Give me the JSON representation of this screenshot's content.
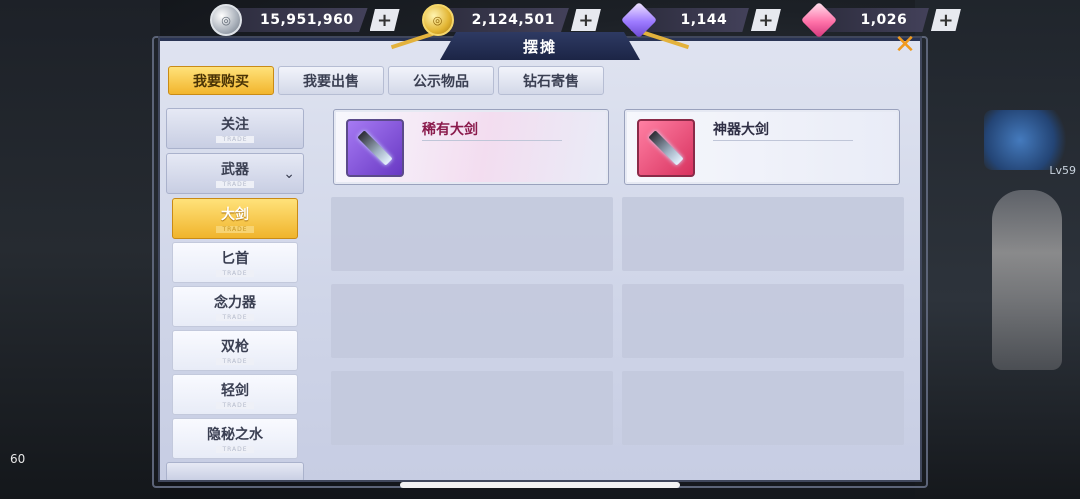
{
  "currencies": [
    {
      "icon": "silver-coin-icon",
      "value": "15,951,960"
    },
    {
      "icon": "gold-coin-icon",
      "value": "2,124,501"
    },
    {
      "icon": "purple-diamond-icon",
      "value": "1,144"
    },
    {
      "icon": "pink-diamond-icon",
      "value": "1,026"
    }
  ],
  "panel": {
    "title": "摆摊"
  },
  "tabs": [
    {
      "label": "我要购买",
      "active": true
    },
    {
      "label": "我要出售",
      "active": false
    },
    {
      "label": "公示物品",
      "active": false
    },
    {
      "label": "钻石寄售",
      "active": false
    }
  ],
  "sidebar": {
    "categories": [
      {
        "label": "关注",
        "sub": "TRADE"
      },
      {
        "label": "武器",
        "sub": "TRADE",
        "expanded": true
      }
    ],
    "subcategories": [
      {
        "label": "大剑",
        "sub": "TRADE",
        "active": true
      },
      {
        "label": "匕首",
        "sub": "TRADE"
      },
      {
        "label": "念力器",
        "sub": "TRADE"
      },
      {
        "label": "双枪",
        "sub": "TRADE"
      },
      {
        "label": "轻剑",
        "sub": "TRADE"
      },
      {
        "label": "隐秘之水",
        "sub": "TRADE"
      }
    ]
  },
  "items": [
    {
      "name": "稀有大剑",
      "rarity": "rare",
      "color": "#8a1a4c"
    },
    {
      "name": "神器大剑",
      "rarity": "artifact",
      "color": "#2f2f45"
    }
  ],
  "side_info": {
    "level_text": "Lv59"
  },
  "fps": "60"
}
